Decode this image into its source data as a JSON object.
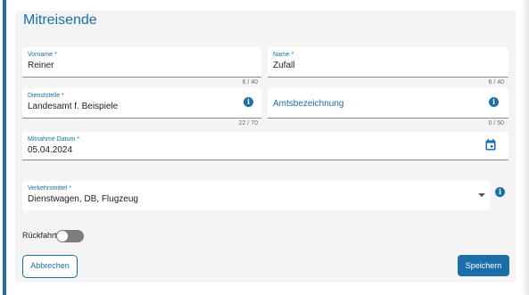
{
  "section": {
    "title": "Mitreisende"
  },
  "vorname": {
    "label": "Vorname *",
    "value": "Reiner",
    "counter": "6 / 40"
  },
  "name": {
    "label": "Name *",
    "value": "Zufall",
    "counter": "6 / 40"
  },
  "dienststelle": {
    "label": "Dienststelle *",
    "value": "Landesamt f. Beispiele",
    "counter": "22 / 70",
    "icon": "info-icon"
  },
  "amtsbezeichnung": {
    "placeholder": "Amtsbezeichnung",
    "counter": "0 / 50",
    "icon": "info-icon"
  },
  "mitnahme_datum": {
    "label": "Mitnahme Datum *",
    "value": "05.04.2024",
    "icon": "calendar-icon"
  },
  "verkehrsmittel": {
    "label": "Verkehrsmittel *",
    "value": "Dienstwagen, DB, Flugzeug",
    "icon": "info-icon"
  },
  "rueckfahrt": {
    "label": "Rückfahrt:",
    "checked": false
  },
  "actions": {
    "cancel_label": "Abbrechen",
    "save_label": "Speichern"
  },
  "colors": {
    "accent": "#1a6fa8",
    "card": "#f4f4f4",
    "toggle_off": "#7d7d7d"
  }
}
